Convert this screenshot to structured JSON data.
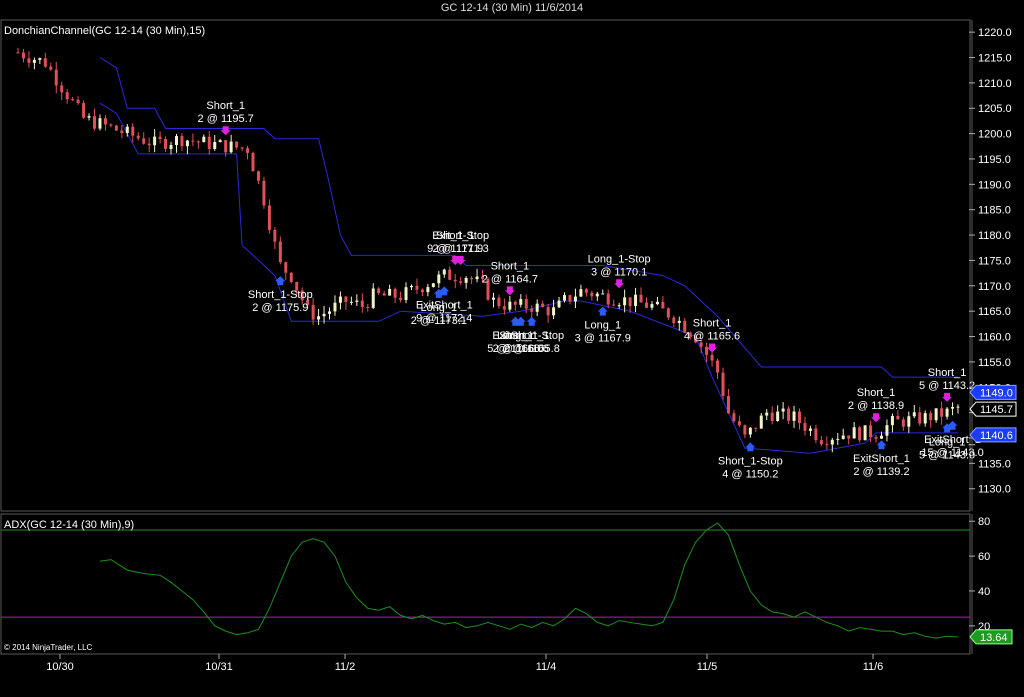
{
  "window": {
    "title": "GC 12-14 (30 Min)  11/6/2014"
  },
  "copyright": "© 2014 NinjaTrader, LLC",
  "colors": {
    "background": "#000000",
    "up_bar": "#f3f3c8",
    "down_bar": "#e0505a",
    "donchian": "#2a2ad8",
    "adx": "#1f8f1f",
    "adx_threshold": "#b020b0",
    "panel_border": "#5a5a5a",
    "long_arrow": "#2a5bff",
    "short_arrow": "#e020e0"
  },
  "chart_data": [
    {
      "type": "candlestick",
      "panel": "price",
      "indicator_label": "DonchianChannel(GC 12-14 (30 Min),15)",
      "x_ticks": [
        "10/30",
        "10/31",
        "11/2",
        "11/4",
        "11/5",
        "11/6"
      ],
      "ylim": [
        1126,
        1222
      ],
      "y_ticks": [
        1130.0,
        1135.0,
        1140.0,
        1145.0,
        1150.0,
        1155.0,
        1160.0,
        1165.0,
        1170.0,
        1175.0,
        1180.0,
        1185.0,
        1190.0,
        1195.0,
        1200.0,
        1205.0,
        1210.0,
        1215.0,
        1220.0
      ],
      "price_markers": [
        {
          "value": 1149.0,
          "text": "1149.0",
          "style": "channel"
        },
        {
          "value": 1145.7,
          "text": "1145.7",
          "style": "last"
        },
        {
          "value": 1140.6,
          "text": "1140.6",
          "style": "channel"
        }
      ],
      "price_path": [
        [
          0,
          1216
        ],
        [
          5,
          1214
        ],
        [
          12,
          1203
        ],
        [
          20,
          1200
        ],
        [
          25,
          1198
        ],
        [
          30,
          1199
        ],
        [
          35,
          1198
        ],
        [
          42,
          1197
        ],
        [
          45,
          1187
        ],
        [
          47,
          1178
        ],
        [
          48,
          1174
        ],
        [
          50,
          1172
        ],
        [
          53,
          1165
        ],
        [
          55,
          1164
        ],
        [
          60,
          1167
        ],
        [
          63,
          1166
        ],
        [
          65,
          1168
        ],
        [
          70,
          1168
        ],
        [
          78,
          1172
        ],
        [
          82,
          1172
        ],
        [
          85,
          1170
        ],
        [
          87,
          1167
        ],
        [
          90,
          1166
        ],
        [
          94,
          1166
        ],
        [
          98,
          1165
        ],
        [
          100,
          1167
        ],
        [
          103,
          1169
        ],
        [
          107,
          1168
        ],
        [
          112,
          1167
        ],
        [
          116,
          1166
        ],
        [
          120,
          1164
        ],
        [
          124,
          1160
        ],
        [
          128,
          1153
        ],
        [
          130,
          1145
        ],
        [
          133,
          1140
        ],
        [
          137,
          1145
        ],
        [
          142,
          1144
        ],
        [
          147,
          1140
        ],
        [
          152,
          1141
        ],
        [
          157,
          1141
        ],
        [
          160,
          1143
        ],
        [
          166,
          1144
        ],
        [
          170,
          1145
        ],
        [
          172,
          1146
        ]
      ],
      "donchian_upper": [
        [
          15,
          1215
        ],
        [
          18,
          1213
        ],
        [
          20,
          1205
        ],
        [
          25,
          1205
        ],
        [
          27,
          1201
        ],
        [
          45,
          1201
        ],
        [
          47,
          1199
        ],
        [
          55,
          1199
        ],
        [
          57,
          1190
        ],
        [
          59,
          1180
        ],
        [
          61,
          1176
        ],
        [
          80,
          1176
        ],
        [
          82,
          1174
        ],
        [
          103,
          1174
        ],
        [
          107,
          1174
        ],
        [
          118,
          1172
        ],
        [
          122,
          1170
        ],
        [
          128,
          1164
        ],
        [
          136,
          1154
        ],
        [
          138,
          1154
        ],
        [
          158,
          1154
        ],
        [
          160,
          1152
        ],
        [
          172,
          1152
        ]
      ],
      "donchian_lower": [
        [
          15,
          1206
        ],
        [
          18,
          1204
        ],
        [
          22,
          1196
        ],
        [
          40,
          1196
        ],
        [
          41,
          1178
        ],
        [
          47,
          1172
        ],
        [
          50,
          1163
        ],
        [
          66,
          1163
        ],
        [
          70,
          1165
        ],
        [
          85,
          1164
        ],
        [
          92,
          1165
        ],
        [
          100,
          1167
        ],
        [
          103,
          1167
        ],
        [
          112,
          1165
        ],
        [
          124,
          1160
        ],
        [
          127,
          1152
        ],
        [
          130,
          1145
        ],
        [
          133,
          1138
        ],
        [
          145,
          1137
        ],
        [
          150,
          1138
        ],
        [
          155,
          1139
        ],
        [
          157,
          1141
        ],
        [
          172,
          1141
        ]
      ],
      "annotations": [
        {
          "name": "Short_1",
          "text": "2 @ 1195.7",
          "bar": 38,
          "side": "short"
        },
        {
          "name": "Short_1-Stop",
          "text": "2 @ 1175.9",
          "bar": 48,
          "side": "long"
        },
        {
          "name": "Short_1",
          "text": "9 @ 1171.9",
          "bar": 80,
          "side": "short"
        },
        {
          "name": "Exit_1-Stop",
          "text": "2 @ 1171.3",
          "bar": 81,
          "side": "short"
        },
        {
          "name": "Long_1",
          "text": "2 @ 1173.1",
          "bar": 77,
          "side": "long"
        },
        {
          "name": "ExitShort_1",
          "text": "9 @ 1172.4",
          "bar": 78,
          "side": "long"
        },
        {
          "name": "Short_1",
          "text": "2 @ 1164.7",
          "bar": 90,
          "side": "short"
        },
        {
          "name": "Long_1",
          "text": "5 @ 1166.0",
          "bar": 91,
          "side": "long"
        },
        {
          "name": "Short_1-Stop",
          "text": "2 @ 1165.8",
          "bar": 94,
          "side": "long"
        },
        {
          "name": "ExitShort_1",
          "text": "2 @ 1166.6",
          "bar": 92,
          "side": "long"
        },
        {
          "name": "Long_1-Stop",
          "text": "3 @ 1170.1",
          "bar": 110,
          "side": "short"
        },
        {
          "name": "Long_1",
          "text": "3 @ 1167.9",
          "bar": 107,
          "side": "long"
        },
        {
          "name": "Short_1",
          "text": "4 @ 1165.6",
          "bar": 127,
          "side": "short"
        },
        {
          "name": "Short_1-Stop",
          "text": "4 @ 1150.2",
          "bar": 134,
          "side": "long"
        },
        {
          "name": "Short_1",
          "text": "2 @ 1138.9",
          "bar": 157,
          "side": "short"
        },
        {
          "name": "ExitShort_1",
          "text": "2 @ 1139.2",
          "bar": 158,
          "side": "long"
        },
        {
          "name": "Short_1",
          "text": "5 @ 1143.2",
          "bar": 170,
          "side": "short"
        },
        {
          "name": "Long_1",
          "text": "5 @ 1143.0",
          "bar": 170,
          "side": "long"
        },
        {
          "name": "ExitShort_1",
          "text": "15 @ 1143.0",
          "bar": 171,
          "side": "long"
        }
      ]
    },
    {
      "type": "line",
      "panel": "indicator",
      "indicator_label": "ADX(GC 12-14 (30 Min),9)",
      "ylim": [
        5,
        83
      ],
      "y_ticks": [
        20,
        40,
        60,
        80
      ],
      "threshold": 25,
      "last_value": {
        "value": 13.64,
        "text": "13.64"
      },
      "series": [
        {
          "values": [
            [
              15,
              57
            ],
            [
              17,
              58
            ],
            [
              20,
              52
            ],
            [
              23,
              50
            ],
            [
              26,
              49
            ],
            [
              28,
              45
            ],
            [
              30,
              40
            ],
            [
              32,
              35
            ],
            [
              34,
              28
            ],
            [
              36,
              20
            ],
            [
              38,
              17
            ],
            [
              40,
              15
            ],
            [
              42,
              16
            ],
            [
              44,
              18
            ],
            [
              46,
              30
            ],
            [
              48,
              45
            ],
            [
              50,
              60
            ],
            [
              52,
              68
            ],
            [
              54,
              70
            ],
            [
              56,
              68
            ],
            [
              58,
              60
            ],
            [
              60,
              45
            ],
            [
              62,
              36
            ],
            [
              64,
              30
            ],
            [
              66,
              29
            ],
            [
              68,
              31
            ],
            [
              70,
              26
            ],
            [
              72,
              24
            ],
            [
              74,
              26
            ],
            [
              76,
              23
            ],
            [
              78,
              21
            ],
            [
              80,
              22
            ],
            [
              82,
              19
            ],
            [
              84,
              20
            ],
            [
              86,
              22
            ],
            [
              88,
              20
            ],
            [
              90,
              18
            ],
            [
              92,
              21
            ],
            [
              94,
              19
            ],
            [
              96,
              22
            ],
            [
              98,
              20
            ],
            [
              100,
              24
            ],
            [
              102,
              30
            ],
            [
              104,
              27
            ],
            [
              106,
              22
            ],
            [
              108,
              20
            ],
            [
              110,
              23
            ],
            [
              112,
              22
            ],
            [
              114,
              21
            ],
            [
              116,
              20
            ],
            [
              118,
              22
            ],
            [
              120,
              35
            ],
            [
              122,
              55
            ],
            [
              124,
              68
            ],
            [
              126,
              75
            ],
            [
              128,
              79
            ],
            [
              130,
              72
            ],
            [
              132,
              55
            ],
            [
              134,
              40
            ],
            [
              136,
              32
            ],
            [
              138,
              28
            ],
            [
              140,
              27
            ],
            [
              142,
              25
            ],
            [
              144,
              28
            ],
            [
              146,
              25
            ],
            [
              148,
              22
            ],
            [
              150,
              20
            ],
            [
              152,
              17
            ],
            [
              154,
              19
            ],
            [
              156,
              18
            ],
            [
              158,
              17
            ],
            [
              160,
              17
            ],
            [
              162,
              15
            ],
            [
              164,
              16
            ],
            [
              166,
              14
            ],
            [
              168,
              13
            ],
            [
              170,
              14
            ],
            [
              172,
              13.6
            ]
          ]
        }
      ]
    }
  ]
}
